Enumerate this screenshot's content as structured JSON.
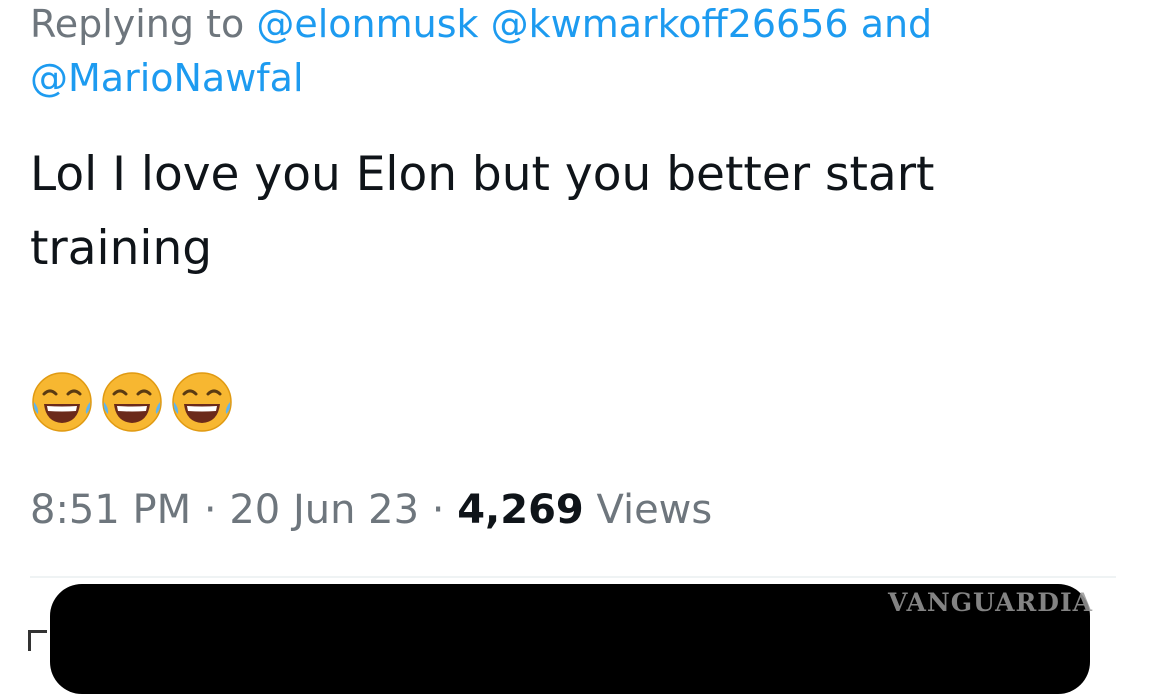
{
  "reply": {
    "prefix": "Replying to",
    "mention_1": "@elonmusk",
    "mention_2": "@kwmarkoff26656",
    "conjunction": "and",
    "mention_3": "@MarioNawfal"
  },
  "tweet": {
    "text": "Lol I love you Elon but you better start training",
    "emojis": [
      "face-with-tears-of-joy-icon",
      "face-with-tears-of-joy-icon",
      "face-with-tears-of-joy-icon"
    ]
  },
  "meta": {
    "time": "8:51 PM",
    "separator": "·",
    "date": "20 Jun 23",
    "views_count": "4,269",
    "views_label": "Views"
  },
  "watermark": "VANGUARDIA",
  "colors": {
    "link": "#1d9bf0",
    "muted": "#6e767d",
    "text": "#0f1419",
    "emoji_face": "#f7b731"
  }
}
